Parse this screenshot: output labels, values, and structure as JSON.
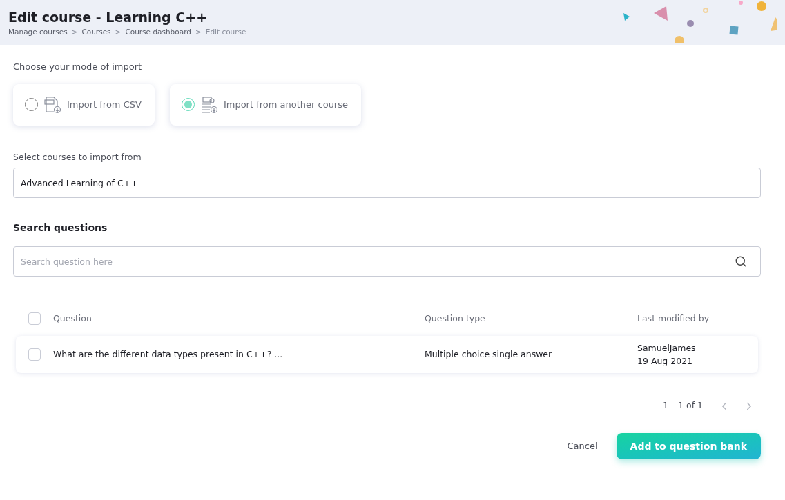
{
  "header": {
    "title": "Edit course - Learning C++",
    "breadcrumbs": [
      "Manage courses",
      "Courses",
      "Course dashboard",
      "Edit course"
    ],
    "separator": ">"
  },
  "import_mode": {
    "label": "Choose your mode of import",
    "options": [
      {
        "kind": "csv",
        "label": "Import from CSV",
        "selected": false
      },
      {
        "kind": "course",
        "label": "Import from another course",
        "selected": true
      }
    ]
  },
  "course_select": {
    "label": "Select courses to import from",
    "value": "Advanced Learning of C++"
  },
  "search": {
    "label": "Search questions",
    "placeholder": "Search question here"
  },
  "table": {
    "header_checked": false,
    "columns": [
      "Question",
      "Question type",
      "Last modified by"
    ],
    "rows": [
      {
        "checked": false,
        "question": "What are the different data types present in C++? ...",
        "type": "Multiple choice single answer",
        "modified_by": "SamuelJames",
        "modified_date": "19 Aug 2021"
      }
    ]
  },
  "pagination": {
    "range": "1 – 1 of 1",
    "prev_disabled": true,
    "next_disabled": true
  },
  "actions": {
    "cancel": "Cancel",
    "submit": "Add to question bank"
  }
}
